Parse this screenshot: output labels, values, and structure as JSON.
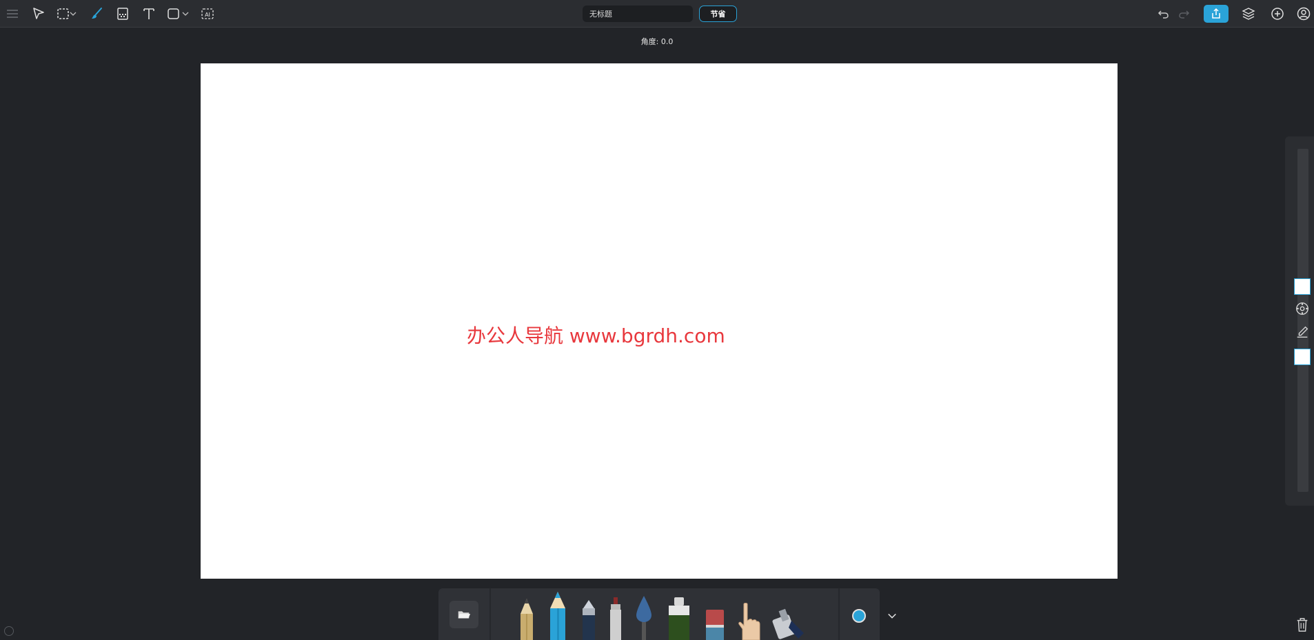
{
  "header": {
    "title_value": "无标题",
    "save_label": "节省"
  },
  "canvas": {
    "angle_label": "角度: 0.0",
    "watermark_text": "办公人导航 www.bgrdh.com"
  },
  "colors": {
    "accent": "#2aa3d8",
    "background": "#222428",
    "toolbar": "#2b2d31",
    "canvas": "#ffffff",
    "watermark": "#e8383d"
  },
  "toolbar_icons": [
    "menu-icon",
    "pointer-icon",
    "rect-select-icon",
    "brush-icon",
    "texture-icon",
    "text-icon",
    "shape-icon",
    "ai-icon"
  ],
  "right_icons": [
    "undo-icon",
    "redo-icon",
    "share-icon",
    "layers-icon",
    "add-icon",
    "user-icon"
  ],
  "brushes": [
    "pencil",
    "colored-pencil",
    "pen",
    "marker",
    "watercolor",
    "airbrush",
    "eraser",
    "smudge-finger",
    "stamp"
  ]
}
